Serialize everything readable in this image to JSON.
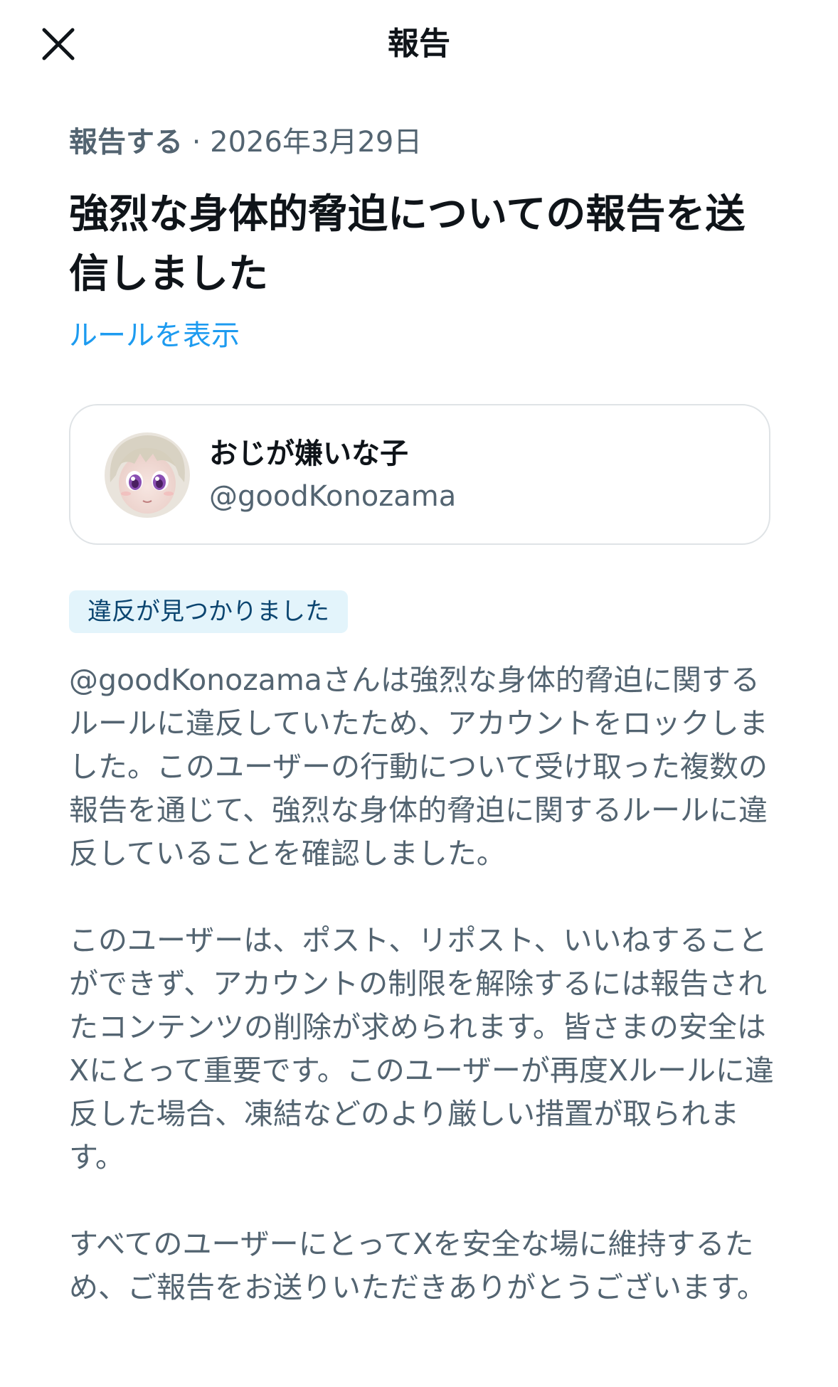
{
  "header": {
    "title": "報告",
    "close_icon": "close-icon"
  },
  "report": {
    "meta_label": "報告する",
    "meta_separator": " · ",
    "meta_date": "2026年3月29日",
    "title": "強烈な身体的脅迫についての報告を送信しました",
    "rules_link": "ルールを表示"
  },
  "user": {
    "name": "おじが嫌いな子",
    "handle": "@goodKonozama",
    "avatar_icon": "avatar-image"
  },
  "status_badge": "違反が見つかりました",
  "body": {
    "paragraph1": "@goodKonozamaさんは強烈な身体的脅迫に関するルールに違反していたため、アカウントをロックしました。このユーザーの行動について受け取った複数の報告を通じて、強烈な身体的脅迫に関するルールに違反していることを確認しました。",
    "paragraph2": "このユーザーは、ポスト、リポスト、いいねすることができず、アカウントの制限を解除するには報告されたコンテンツの削除が求められます。皆さまの安全はXにとって重要です。このユーザーが再度Xルールに違反した場合、凍結などのより厳しい措置が取られます。",
    "paragraph3": "すべてのユーザーにとってXを安全な場に維持するため、ご報告をお送りいただきありがとうございます。"
  },
  "colors": {
    "link": "#1d9bf0",
    "text_primary": "#0f1419",
    "text_secondary": "#536471",
    "badge_bg": "#e3f4fb",
    "badge_text": "#0b4570"
  }
}
